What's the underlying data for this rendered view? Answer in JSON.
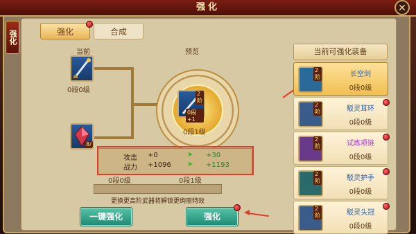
{
  "window": {
    "title": "强化",
    "side_tab": "强化",
    "close_glyph": "✕"
  },
  "tabs": [
    {
      "label": "强化",
      "active": true
    },
    {
      "label": "合成",
      "active": false
    }
  ],
  "labels": {
    "current": "当前",
    "preview": "预览"
  },
  "current_item": {
    "level_text": "0段0级"
  },
  "current_gem": {
    "count": "8/"
  },
  "preview_item": {
    "badge": "2阶",
    "inner_level": "0段+1",
    "level_text": "0段1级"
  },
  "stats": [
    {
      "name": "攻击",
      "current": "+0",
      "next": "+30"
    },
    {
      "name": "战力",
      "current": "+1096",
      "next": "+1193"
    }
  ],
  "bottom_level_left": "0段0级",
  "bottom_level_right": "0段1级",
  "hint": "更换更高阶武器将解锁更绚丽特效",
  "buttons": {
    "one_click": "一键强化",
    "strengthen": "强化"
  },
  "right_panel": {
    "header": "当前可强化装备",
    "items": [
      {
        "badge": "2阶",
        "name": "长空剑",
        "level": "0段0级",
        "selected": true,
        "icon_color": "#2a6a9a",
        "name_color": "#2f5ea8"
      },
      {
        "badge": "2阶",
        "name": "駁灵耳环",
        "level": "0段0级",
        "selected": false,
        "icon_color": "#3a5c8a",
        "name_color": "#2f5ea8"
      },
      {
        "badge": "2阶",
        "name": "试炼项链",
        "level": "0段0级",
        "selected": false,
        "icon_color": "#6a3a8a",
        "name_color": "#a43ac4"
      },
      {
        "badge": "2阶",
        "name": "駁灵护手",
        "level": "0段0级",
        "selected": false,
        "icon_color": "#2a6a6a",
        "name_color": "#2f5ea8"
      },
      {
        "badge": "2阶",
        "name": "駁灵头冠",
        "level": "0段0级",
        "selected": false,
        "icon_color": "#3a5c8a",
        "name_color": "#2f5ea8"
      }
    ]
  }
}
